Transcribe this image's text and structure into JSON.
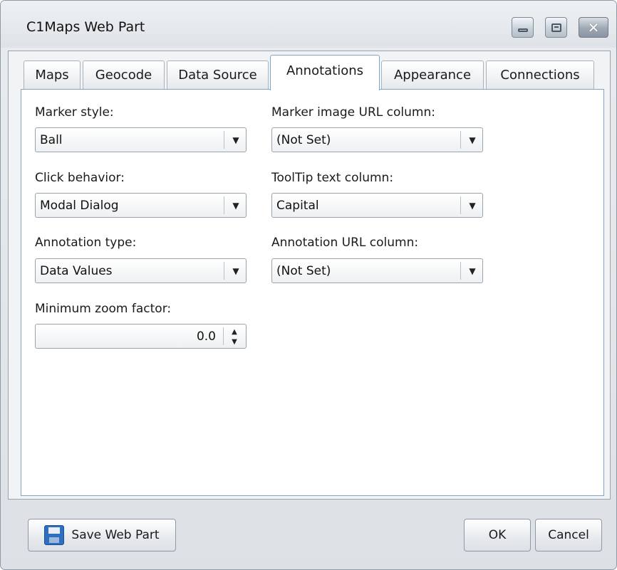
{
  "window": {
    "title": "C1Maps Web Part",
    "controls": {
      "minimize_icon": "minimize-icon",
      "maximize_icon": "maximize-icon",
      "close_glyph": "✕"
    }
  },
  "tabs": [
    {
      "label": "Maps",
      "active": false
    },
    {
      "label": "Geocode",
      "active": false
    },
    {
      "label": "Data Source",
      "active": false
    },
    {
      "label": "Annotations",
      "active": true
    },
    {
      "label": "Appearance",
      "active": false
    },
    {
      "label": "Connections",
      "active": false
    }
  ],
  "annotations": {
    "marker_style": {
      "label": "Marker style:",
      "value": "Ball"
    },
    "marker_image_url_column": {
      "label": "Marker image URL column:",
      "value": "(Not Set)"
    },
    "click_behavior": {
      "label": "Click behavior:",
      "value": "Modal Dialog"
    },
    "tooltip_text_column": {
      "label": "ToolTip text column:",
      "value": "Capital"
    },
    "annotation_type": {
      "label": "Annotation type:",
      "value": "Data Values"
    },
    "annotation_url_column": {
      "label": "Annotation URL column:",
      "value": "(Not Set)"
    },
    "minimum_zoom_factor": {
      "label": "Minimum zoom factor:",
      "value": "0.0"
    }
  },
  "glyphs": {
    "dropdown": "▼",
    "spin_up": "▲",
    "spin_down": "▼"
  },
  "footer": {
    "save_label": "Save Web Part",
    "save_icon": "floppy-disk-icon",
    "ok_label": "OK",
    "cancel_label": "Cancel"
  }
}
